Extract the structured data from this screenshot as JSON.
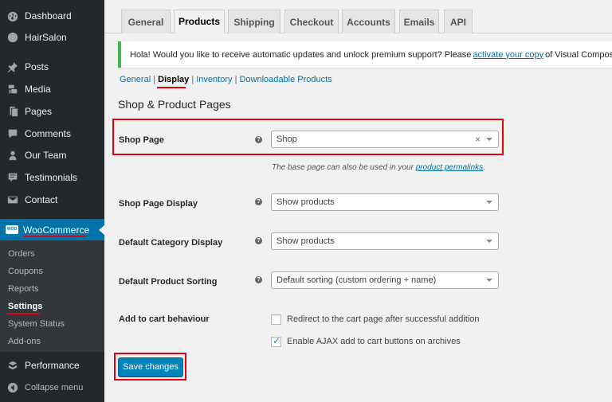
{
  "sidebar": {
    "items": [
      {
        "label": "Dashboard",
        "icon": "dashboard-icon"
      },
      {
        "label": "HairSalon",
        "icon": "theme-icon"
      },
      {
        "label": "Posts",
        "icon": "pin-icon"
      },
      {
        "label": "Media",
        "icon": "media-icon"
      },
      {
        "label": "Pages",
        "icon": "pages-icon"
      },
      {
        "label": "Comments",
        "icon": "comment-icon"
      },
      {
        "label": "Our Team",
        "icon": "users-icon"
      },
      {
        "label": "Testimonials",
        "icon": "testimonials-icon"
      },
      {
        "label": "Contact",
        "icon": "mail-icon"
      }
    ],
    "woocommerce": {
      "label": "WooCommerce",
      "logo_text": "WOO"
    },
    "submenu": [
      "Orders",
      "Coupons",
      "Reports",
      "Settings",
      "System Status",
      "Add-ons"
    ],
    "performance": "Performance",
    "collapse": "Collapse menu"
  },
  "tabs": [
    "General",
    "Products",
    "Shipping",
    "Checkout",
    "Accounts",
    "Emails",
    "API"
  ],
  "notice": {
    "text_before": "Hola! Would you like to receive automatic updates and unlock premium support? Please ",
    "link": "activate your copy",
    "text_after": " of Visual Composer."
  },
  "subsub": {
    "general": "General",
    "display": "Display",
    "inventory": "Inventory",
    "downloadable": "Downloadable Products"
  },
  "section_title": "Shop & Product Pages",
  "fields": {
    "shop_page": {
      "label": "Shop Page",
      "value": "Shop",
      "clear": "×"
    },
    "shop_page_desc": {
      "before": "The base page can also be used in your ",
      "link": "product permalinks",
      "after": "."
    },
    "shop_page_display": {
      "label": "Shop Page Display",
      "value": "Show products"
    },
    "default_category_display": {
      "label": "Default Category Display",
      "value": "Show products"
    },
    "default_product_sorting": {
      "label": "Default Product Sorting",
      "value": "Default sorting (custom ordering + name)"
    },
    "add_to_cart": {
      "label": "Add to cart behaviour",
      "options": [
        {
          "label": "Redirect to the cart page after successful addition",
          "checked": false
        },
        {
          "label": "Enable AJAX add to cart buttons on archives",
          "checked": true
        }
      ]
    }
  },
  "help_glyph": "?",
  "save_button": "Save changes",
  "colors": {
    "accent": "#0073aa",
    "highlight": "#e3000f",
    "notice_border": "#46b450"
  }
}
